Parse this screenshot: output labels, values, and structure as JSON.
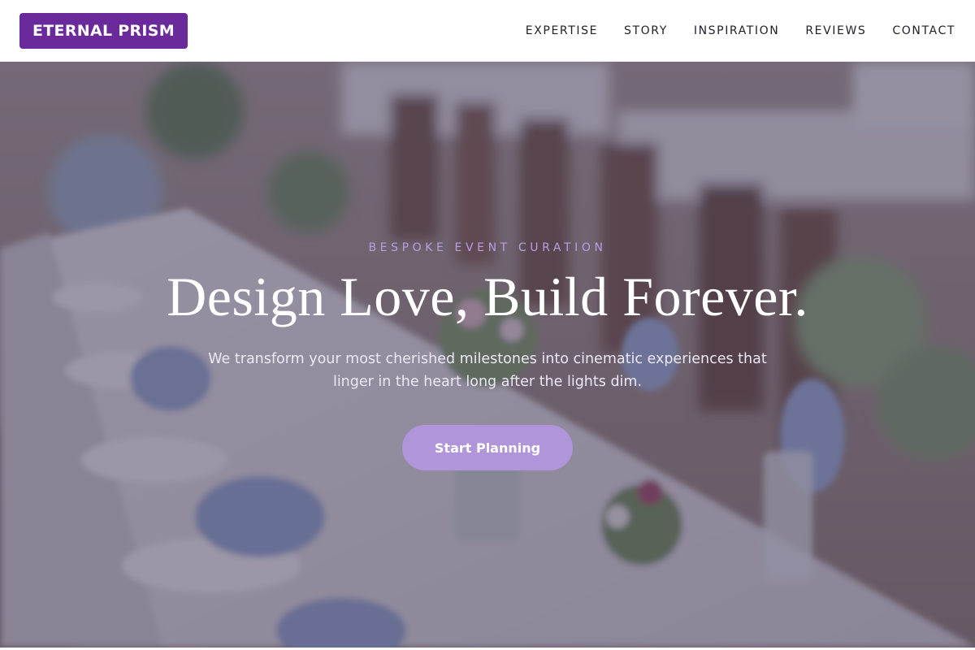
{
  "brand": {
    "name": "ETERNAL PRISM",
    "accent": "#6a2a9c"
  },
  "nav": {
    "items": [
      {
        "label": "EXPERTISE"
      },
      {
        "label": "STORY"
      },
      {
        "label": "INSPIRATION"
      },
      {
        "label": "REVIEWS"
      },
      {
        "label": "CONTACT"
      }
    ]
  },
  "hero": {
    "eyebrow": "BESPOKE EVENT CURATION",
    "headline": "Design Love, Build Forever.",
    "subtext": "We transform your most cherished milestones into cinematic experiences that linger in the heart long after the lights dim.",
    "cta_label": "Start Planning",
    "cta_color": "#b195da",
    "background_image": "wedding-table-photo"
  }
}
